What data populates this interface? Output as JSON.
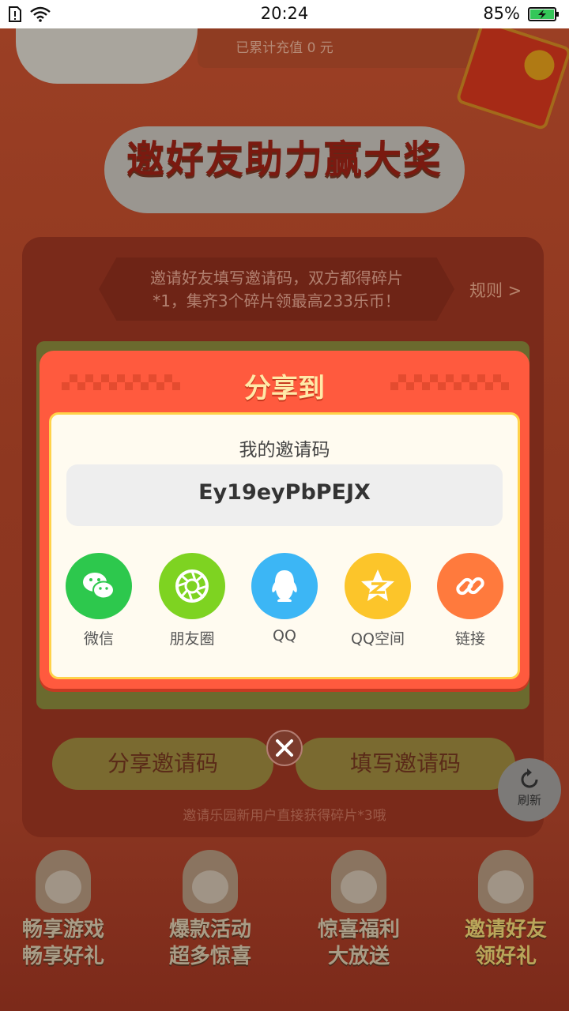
{
  "status_bar": {
    "time": "20:24",
    "battery": "85%"
  },
  "background": {
    "recharge_text": "已累计充值 0 元",
    "banner_title": "邀好友助力赢大奖",
    "intro_line1": "邀请好友填写邀请码，双方都得碎片",
    "intro_line2": "*1，集齐3个碎片领最高233乐币！",
    "rules_link": "规则 >",
    "share_code_button": "分享邀请码",
    "fill_code_button": "填写邀请码",
    "footer_note": "邀请乐园新用户直接获得碎片*3哦",
    "refresh_label": "刷新",
    "nav": [
      {
        "line1": "畅享游戏",
        "line2": "畅享好礼"
      },
      {
        "line1": "爆款活动",
        "line2": "超多惊喜"
      },
      {
        "line1": "惊喜福利",
        "line2": "大放送"
      },
      {
        "line1": "邀请好友",
        "line2": "领好礼"
      }
    ]
  },
  "dialog": {
    "title": "分享到",
    "code_label": "我的邀请码",
    "code_value": "Ey19eyPbPEJX",
    "share_options": [
      {
        "label": "微信",
        "icon": "wechat-icon",
        "color": "#2dc84d"
      },
      {
        "label": "朋友圈",
        "icon": "moments-icon",
        "color": "#7ed321"
      },
      {
        "label": "QQ",
        "icon": "qq-icon",
        "color": "#3cb6f5"
      },
      {
        "label": "QQ空间",
        "icon": "qzone-icon",
        "color": "#fcc52a"
      },
      {
        "label": "链接",
        "icon": "link-icon",
        "color": "#ff7a3d"
      }
    ]
  }
}
